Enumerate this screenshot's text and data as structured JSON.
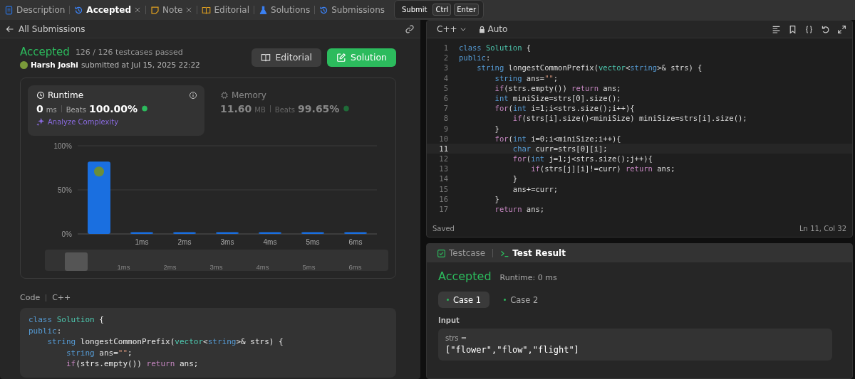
{
  "top_tabs": [
    {
      "label": "Description",
      "selected": false,
      "closable": false
    },
    {
      "label": "Accepted",
      "selected": true,
      "closable": true
    },
    {
      "label": "Note",
      "selected": false,
      "closable": true
    },
    {
      "label": "Editorial",
      "selected": false,
      "closable": false
    },
    {
      "label": "Solutions",
      "selected": false,
      "closable": false
    },
    {
      "label": "Submissions",
      "selected": false,
      "closable": false
    }
  ],
  "submit_hint": {
    "label": "Submit",
    "keys": [
      "Ctrl",
      "Enter"
    ]
  },
  "submission": {
    "back_label": "All Submissions",
    "status": "Accepted",
    "testcases": "126 / 126 testcases passed",
    "user": "Harsh Joshi",
    "submitted": "submitted at Jul 15, 2025 22:22",
    "buttons": [
      {
        "label": "Editorial",
        "kind": "secondary"
      },
      {
        "label": "Solution",
        "kind": "primary"
      }
    ],
    "metrics": [
      {
        "title": "Runtime",
        "value": "0",
        "unit": "ms",
        "beats_label": "Beats",
        "beats": "100.00%",
        "selected": true
      },
      {
        "title": "Memory",
        "value": "11.60",
        "unit": "MB",
        "beats_label": "Beats",
        "beats": "99.65%",
        "selected": false
      }
    ],
    "analyze": "Analyze Complexity",
    "chart_data": {
      "type": "bar",
      "x": [
        0,
        1,
        2,
        3,
        4,
        5,
        6
      ],
      "series": [
        {
          "color": "#1a6fe0",
          "values": [
            82,
            2,
            2,
            2,
            2,
            2,
            2
          ]
        }
      ],
      "xlim": [
        -0.5,
        6.5
      ],
      "ylim": [
        0,
        100
      ],
      "yticks": [
        {
          "value": 0,
          "label": "0%"
        },
        {
          "value": 50,
          "label": "50%"
        },
        {
          "value": 100,
          "label": "100%"
        }
      ],
      "xticks": [
        {
          "value": 1,
          "label": "1ms"
        },
        {
          "value": 2,
          "label": "2ms"
        },
        {
          "value": 3,
          "label": "3ms"
        },
        {
          "value": 4,
          "label": "4ms"
        },
        {
          "value": 5,
          "label": "5ms"
        },
        {
          "value": 6,
          "label": "6ms"
        }
      ]
    },
    "navigator_labels": [
      "1ms",
      "2ms",
      "3ms",
      "4ms",
      "5ms",
      "6ms"
    ],
    "code_label": "Code",
    "code_lang": "C++",
    "code_lines": [
      "class Solution {",
      "public:",
      "    string longestCommonPrefix(vector<string>& strs) {",
      "        string ans=\"\";",
      "        if(strs.empty()) return ans;"
    ]
  },
  "editor": {
    "language": "C++",
    "mode": "Auto",
    "lines": [
      {
        "number": "1",
        "text": "class Solution {",
        "selected": false
      },
      {
        "number": "2",
        "text": "public:",
        "selected": false
      },
      {
        "number": "3",
        "text": "    string longestCommonPrefix(vector<string>& strs) {",
        "selected": false
      },
      {
        "number": "4",
        "text": "        string ans=\"\";",
        "selected": false
      },
      {
        "number": "5",
        "text": "        if(strs.empty()) return ans;",
        "selected": false
      },
      {
        "number": "6",
        "text": "        int miniSize=strs[0].size();",
        "selected": false
      },
      {
        "number": "7",
        "text": "        for(int i=1;i<strs.size();i++){",
        "selected": false
      },
      {
        "number": "8",
        "text": "            if(strs[i].size()<miniSize) miniSize=strs[i].size();",
        "selected": false
      },
      {
        "number": "9",
        "text": "        }",
        "selected": false
      },
      {
        "number": "10",
        "text": "        for(int i=0;i<miniSize;i++){",
        "selected": false
      },
      {
        "number": "11",
        "text": "            char curr=strs[0][i];",
        "selected": true
      },
      {
        "number": "12",
        "text": "            for(int j=1;j<strs.size();j++){",
        "selected": false
      },
      {
        "number": "13",
        "text": "                if(strs[j][i]!=curr) return ans;",
        "selected": false
      },
      {
        "number": "14",
        "text": "            }",
        "selected": false
      },
      {
        "number": "15",
        "text": "            ans+=curr;",
        "selected": false
      },
      {
        "number": "16",
        "text": "        }",
        "selected": false
      },
      {
        "number": "17",
        "text": "        return ans;",
        "selected": false
      }
    ],
    "status": "Saved",
    "position": "Ln 11, Col 32"
  },
  "result": {
    "tabs": [
      {
        "label": "Testcase",
        "selected": false
      },
      {
        "label": "Test Result",
        "selected": true
      }
    ],
    "status": "Accepted",
    "runtime": "Runtime: 0 ms",
    "cases": [
      {
        "label": "Case 1",
        "selected": true
      },
      {
        "label": "Case 2",
        "selected": false
      }
    ],
    "input_label": "Input",
    "var_name": "strs =",
    "value": "[\"flower\",\"flow\",\"flight\"]"
  }
}
